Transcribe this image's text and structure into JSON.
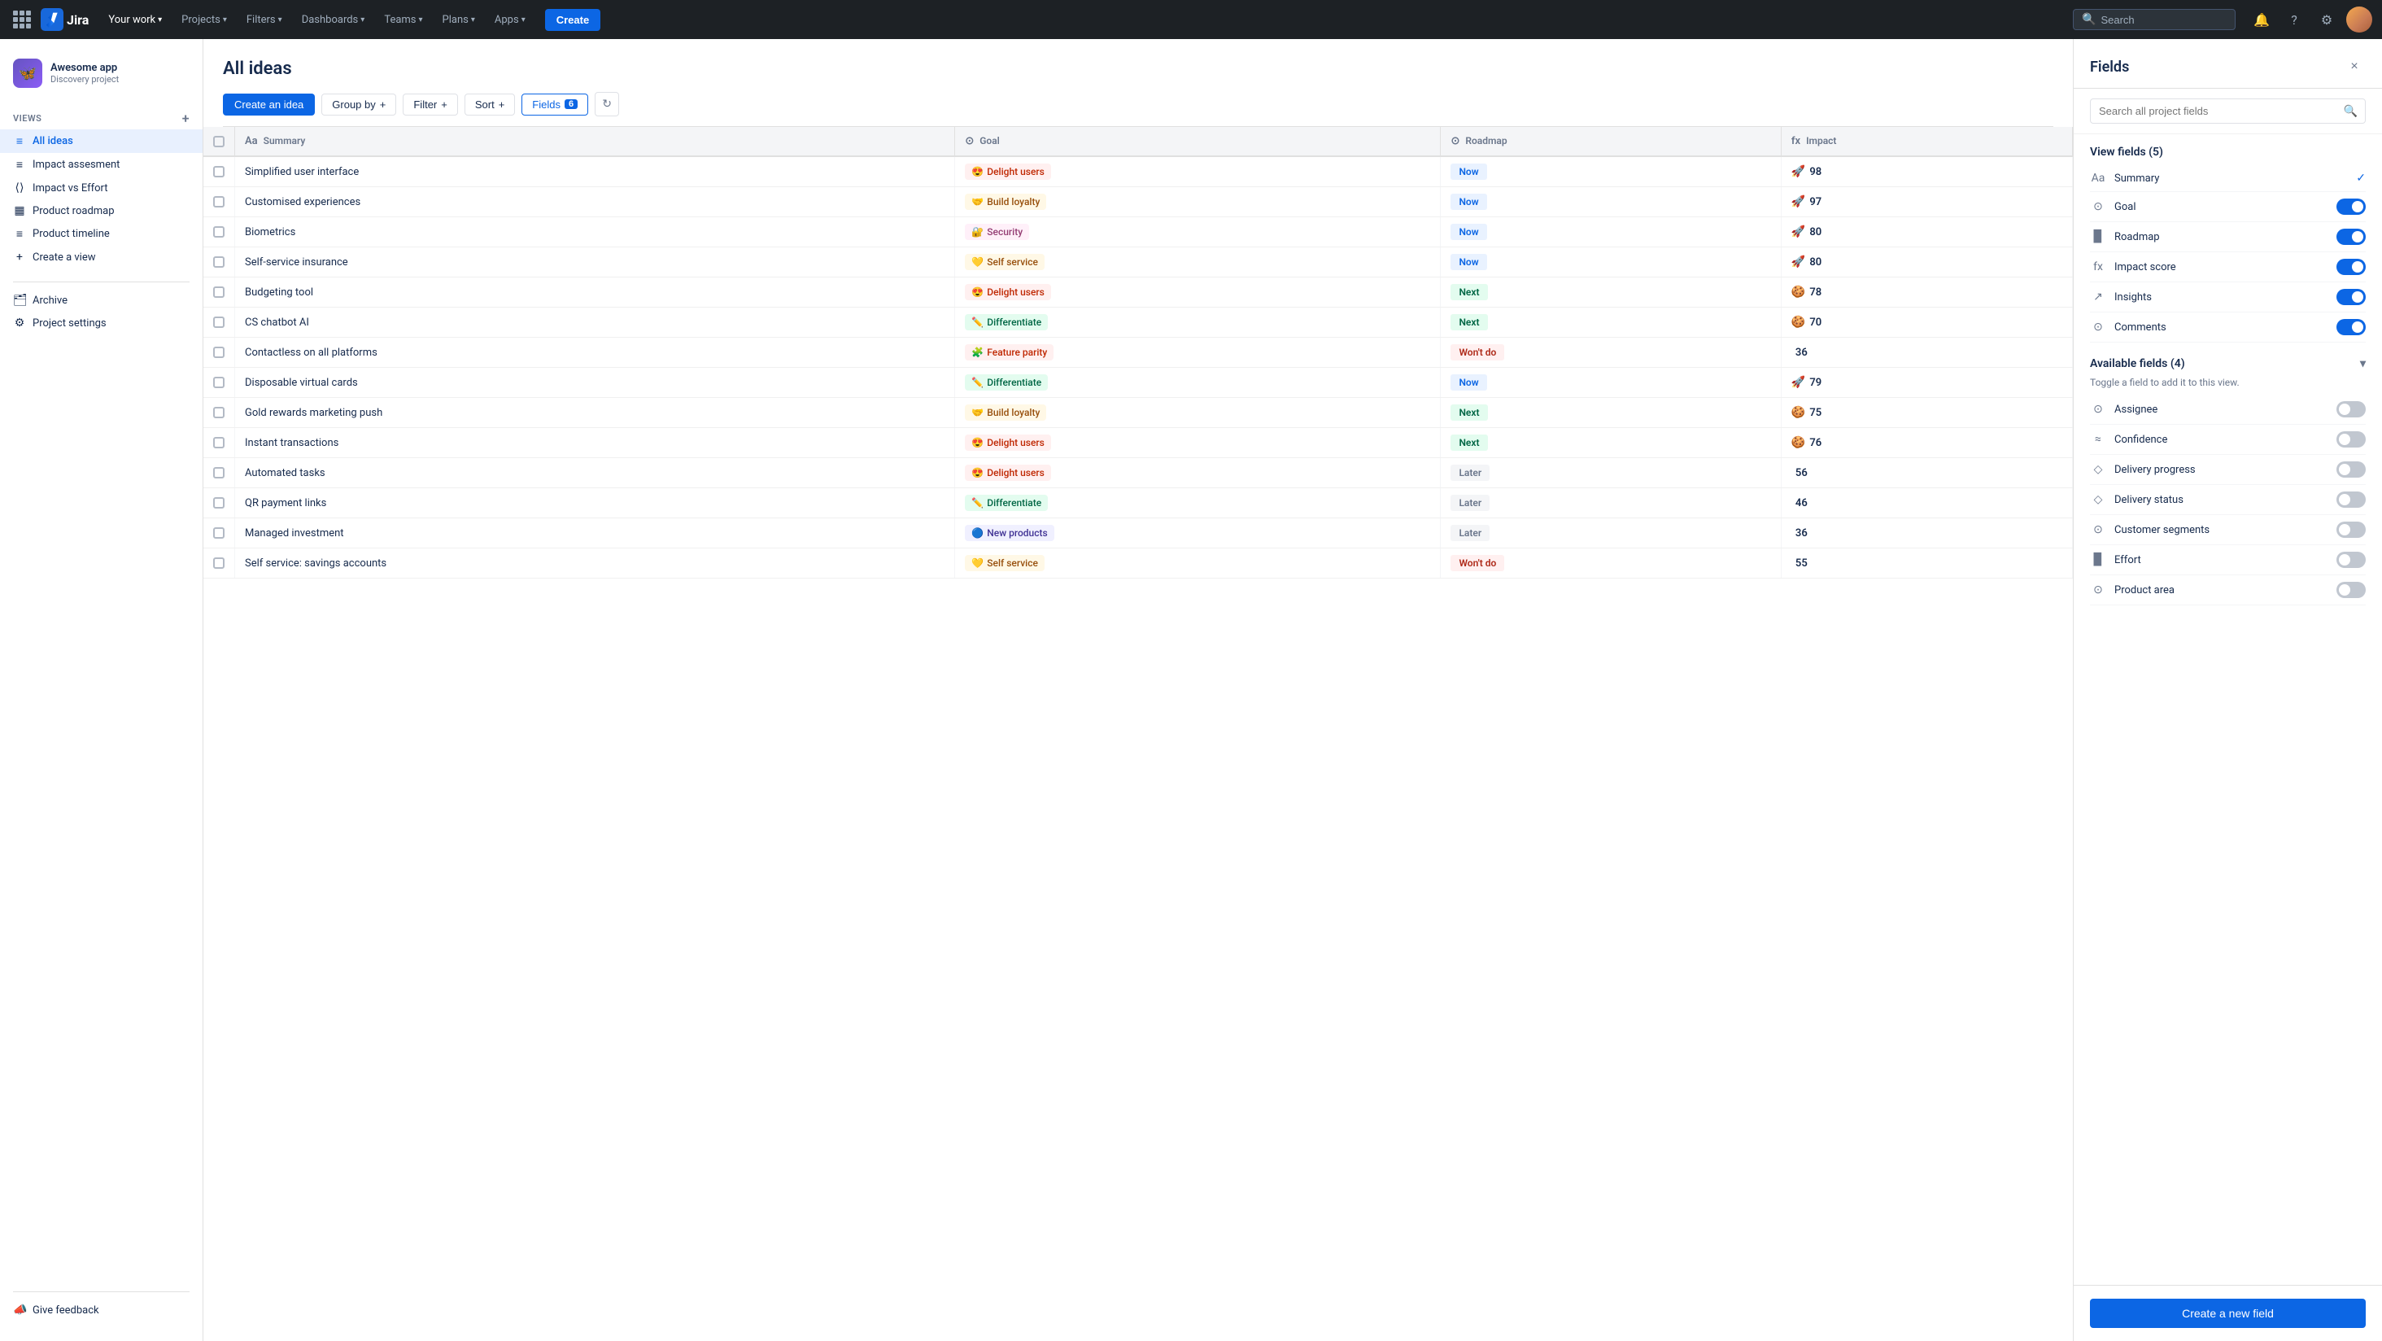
{
  "topnav": {
    "logo_text": "Jira",
    "nav_items": [
      {
        "label": "Your work",
        "has_chevron": true
      },
      {
        "label": "Projects",
        "has_chevron": true
      },
      {
        "label": "Filters",
        "has_chevron": true
      },
      {
        "label": "Dashboards",
        "has_chevron": true
      },
      {
        "label": "Teams",
        "has_chevron": true
      },
      {
        "label": "Plans",
        "has_chevron": true
      },
      {
        "label": "Apps",
        "has_chevron": true
      }
    ],
    "create_label": "Create",
    "search_placeholder": "Search"
  },
  "sidebar": {
    "project_name": "Awesome app",
    "project_type": "Discovery project",
    "views_label": "VIEWS",
    "views_items": [
      {
        "label": "All ideas",
        "active": true,
        "icon": "≡"
      },
      {
        "label": "Impact assesment",
        "icon": "≡"
      },
      {
        "label": "Impact vs Effort",
        "icon": "⟨⟩"
      },
      {
        "label": "Product roadmap",
        "icon": "▦"
      },
      {
        "label": "Product timeline",
        "icon": "≡"
      },
      {
        "label": "Create a view",
        "icon": "+"
      }
    ],
    "archive_label": "Archive",
    "settings_label": "Project settings",
    "feedback_label": "Give feedback"
  },
  "main": {
    "page_title": "All ideas",
    "toolbar": {
      "create_label": "Create an idea",
      "group_by_label": "Group by",
      "filter_label": "Filter",
      "sort_label": "Sort",
      "fields_label": "Fields",
      "fields_count": "6"
    },
    "table": {
      "columns": [
        {
          "label": "",
          "icon": ""
        },
        {
          "label": "Summary",
          "icon": "Aa"
        },
        {
          "label": "Goal",
          "icon": "⊙"
        },
        {
          "label": "Roadmap",
          "icon": "⊙"
        },
        {
          "label": "Impact",
          "icon": "fx"
        }
      ],
      "rows": [
        {
          "summary": "Simplified user interface",
          "goal_emoji": "😍",
          "goal": "Delight users",
          "goal_class": "goal-delight",
          "roadmap": "Now",
          "roadmap_class": "roadmap-now",
          "impact": 98,
          "impact_icon": "🚀"
        },
        {
          "summary": "Customised experiences",
          "goal_emoji": "🤝",
          "goal": "Build loyalty",
          "goal_class": "goal-build",
          "roadmap": "Now",
          "roadmap_class": "roadmap-now",
          "impact": 97,
          "impact_icon": "🚀"
        },
        {
          "summary": "Biometrics",
          "goal_emoji": "🔐",
          "goal": "Security",
          "goal_class": "goal-security",
          "roadmap": "Now",
          "roadmap_class": "roadmap-now",
          "impact": 80,
          "impact_icon": "🚀"
        },
        {
          "summary": "Self-service insurance",
          "goal_emoji": "💛",
          "goal": "Self service",
          "goal_class": "goal-self",
          "roadmap": "Now",
          "roadmap_class": "roadmap-now",
          "impact": 80,
          "impact_icon": "🚀"
        },
        {
          "summary": "Budgeting tool",
          "goal_emoji": "😍",
          "goal": "Delight users",
          "goal_class": "goal-delight",
          "roadmap": "Next",
          "roadmap_class": "roadmap-next",
          "impact": 78,
          "impact_icon": "🍪"
        },
        {
          "summary": "CS chatbot AI",
          "goal_emoji": "✏️",
          "goal": "Differentiate",
          "goal_class": "goal-differentiate",
          "roadmap": "Next",
          "roadmap_class": "roadmap-next",
          "impact": 70,
          "impact_icon": "🍪"
        },
        {
          "summary": "Contactless on all platforms",
          "goal_emoji": "🧩",
          "goal": "Feature parity",
          "goal_class": "goal-feature",
          "roadmap": "Won't do",
          "roadmap_class": "roadmap-wontdo",
          "impact": 36,
          "impact_icon": ""
        },
        {
          "summary": "Disposable virtual cards",
          "goal_emoji": "✏️",
          "goal": "Differentiate",
          "goal_class": "goal-differentiate",
          "roadmap": "Now",
          "roadmap_class": "roadmap-now",
          "impact": 79,
          "impact_icon": "🚀"
        },
        {
          "summary": "Gold rewards marketing push",
          "goal_emoji": "🤝",
          "goal": "Build loyalty",
          "goal_class": "goal-build",
          "roadmap": "Next",
          "roadmap_class": "roadmap-next",
          "impact": 75,
          "impact_icon": "🍪"
        },
        {
          "summary": "Instant transactions",
          "goal_emoji": "😍",
          "goal": "Delight users",
          "goal_class": "goal-delight",
          "roadmap": "Next",
          "roadmap_class": "roadmap-next",
          "impact": 76,
          "impact_icon": "🍪"
        },
        {
          "summary": "Automated tasks",
          "goal_emoji": "😍",
          "goal": "Delight users",
          "goal_class": "goal-delight",
          "roadmap": "Later",
          "roadmap_class": "roadmap-later",
          "impact": 56,
          "impact_icon": ""
        },
        {
          "summary": "QR payment links",
          "goal_emoji": "✏️",
          "goal": "Differentiate",
          "goal_class": "goal-differentiate",
          "roadmap": "Later",
          "roadmap_class": "roadmap-later",
          "impact": 46,
          "impact_icon": ""
        },
        {
          "summary": "Managed investment",
          "goal_emoji": "🔵",
          "goal": "New products",
          "goal_class": "goal-new",
          "roadmap": "Later",
          "roadmap_class": "roadmap-later",
          "impact": 36,
          "impact_icon": ""
        },
        {
          "summary": "Self service: savings accounts",
          "goal_emoji": "💛",
          "goal": "Self service",
          "goal_class": "goal-self",
          "roadmap": "Won't do",
          "roadmap_class": "roadmap-wontdo",
          "impact": 55,
          "impact_icon": ""
        }
      ]
    }
  },
  "fields_panel": {
    "title": "Fields",
    "search_placeholder": "Search all project fields",
    "close_label": "×",
    "view_fields_section": "View fields (5)",
    "view_fields": [
      {
        "name": "Summary",
        "icon": "Aa",
        "toggled": "check"
      },
      {
        "name": "Goal",
        "icon": "⊙",
        "toggled": "on"
      },
      {
        "name": "Roadmap",
        "icon": "▉",
        "toggled": "on"
      },
      {
        "name": "Impact score",
        "icon": "fx",
        "toggled": "on"
      },
      {
        "name": "Insights",
        "icon": "↗",
        "toggled": "on"
      },
      {
        "name": "Comments",
        "icon": "⊙",
        "toggled": "on"
      }
    ],
    "available_fields_section": "Available fields (4)",
    "available_fields_desc": "Toggle a field to add it to this view.",
    "available_fields": [
      {
        "name": "Assignee",
        "icon": "⊙"
      },
      {
        "name": "Confidence",
        "icon": "≈"
      },
      {
        "name": "Delivery progress",
        "icon": "◇"
      },
      {
        "name": "Delivery status",
        "icon": "◇"
      },
      {
        "name": "Customer segments",
        "icon": "⊙"
      },
      {
        "name": "Effort",
        "icon": "▉"
      },
      {
        "name": "Product area",
        "icon": "⊙"
      }
    ],
    "create_button_label": "Create a new field"
  }
}
